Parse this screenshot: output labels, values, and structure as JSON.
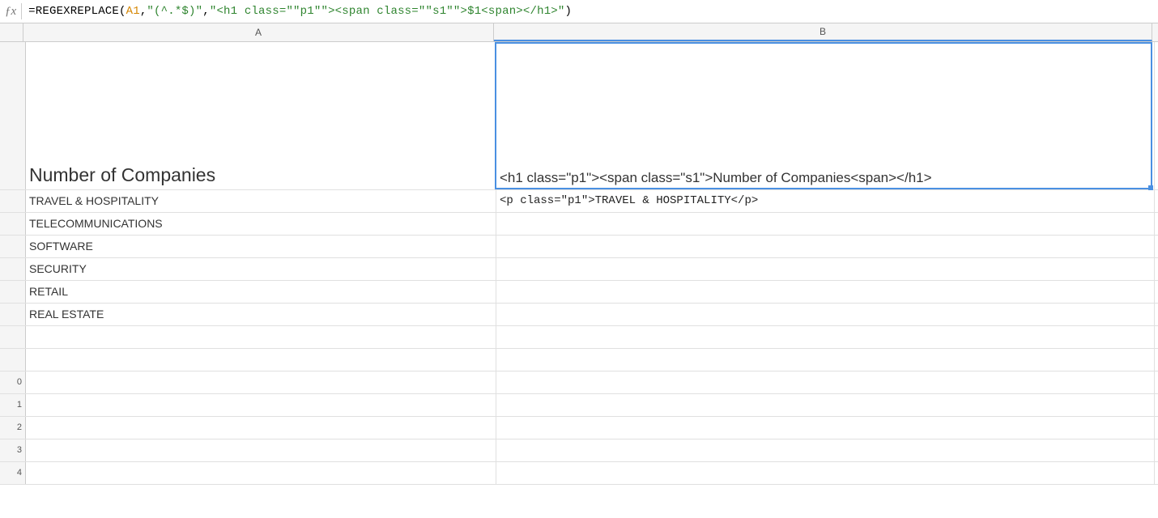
{
  "formula": {
    "eq": "=",
    "func": "REGEXREPLACE",
    "open": "(",
    "ref": "A1",
    "comma1": ",",
    "arg2": "\"(^.*$)\"",
    "comma2": ",",
    "arg3": "\"<h1 class=\"\"p1\"\"><span class=\"\"s1\"\">$1<span></h1>\"",
    "close": ")"
  },
  "columns": {
    "a": "A",
    "b": "B"
  },
  "rownums": [
    "",
    "",
    "",
    "",
    "",
    "",
    "",
    "",
    "",
    "0",
    "1",
    "2",
    "3",
    "4"
  ],
  "cells": {
    "a1": "Number of Companies",
    "b1": "<h1 class=\"p1\"><span class=\"s1\">Number of Companies<span></h1>",
    "a2": "TRAVEL & HOSPITALITY",
    "b2": "<p class=\"p1\">TRAVEL & HOSPITALITY</p>",
    "a3": "TELECOMMUNICATIONS",
    "a4": "SOFTWARE",
    "a5": "SECURITY",
    "a6": "RETAIL",
    "a7": "REAL ESTATE"
  }
}
